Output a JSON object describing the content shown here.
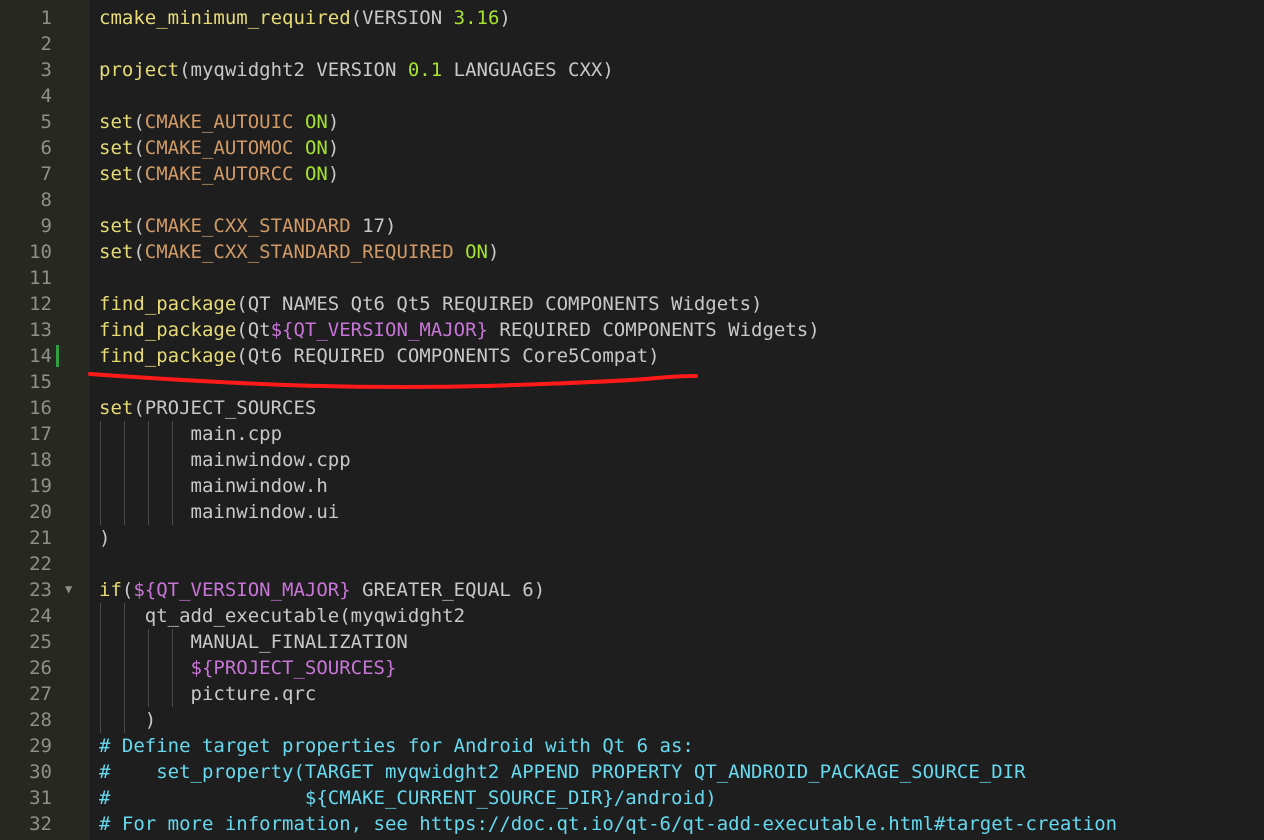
{
  "editor": {
    "lines": [
      {
        "n": "1",
        "tokens": [
          [
            "fn",
            "cmake_minimum_required"
          ],
          [
            "arg",
            "(VERSION "
          ],
          [
            "ver",
            "3.16"
          ],
          [
            "arg",
            ")"
          ]
        ]
      },
      {
        "n": "2",
        "tokens": []
      },
      {
        "n": "3",
        "tokens": [
          [
            "fn",
            "project"
          ],
          [
            "arg",
            "(myqwidght2 VERSION "
          ],
          [
            "ver",
            "0.1"
          ],
          [
            "arg",
            " LANGUAGES CXX)"
          ]
        ]
      },
      {
        "n": "4",
        "tokens": []
      },
      {
        "n": "5",
        "tokens": [
          [
            "fn",
            "set"
          ],
          [
            "arg",
            "("
          ],
          [
            "var2",
            "CMAKE_AUTOUIC"
          ],
          [
            "arg",
            " "
          ],
          [
            "on",
            "ON"
          ],
          [
            "arg",
            ")"
          ]
        ]
      },
      {
        "n": "6",
        "tokens": [
          [
            "fn",
            "set"
          ],
          [
            "arg",
            "("
          ],
          [
            "var2",
            "CMAKE_AUTOMOC"
          ],
          [
            "arg",
            " "
          ],
          [
            "on",
            "ON"
          ],
          [
            "arg",
            ")"
          ]
        ]
      },
      {
        "n": "7",
        "tokens": [
          [
            "fn",
            "set"
          ],
          [
            "arg",
            "("
          ],
          [
            "var2",
            "CMAKE_AUTORCC"
          ],
          [
            "arg",
            " "
          ],
          [
            "on",
            "ON"
          ],
          [
            "arg",
            ")"
          ]
        ]
      },
      {
        "n": "8",
        "tokens": []
      },
      {
        "n": "9",
        "tokens": [
          [
            "fn",
            "set"
          ],
          [
            "arg",
            "("
          ],
          [
            "var2",
            "CMAKE_CXX_STANDARD"
          ],
          [
            "arg",
            " 17)"
          ]
        ]
      },
      {
        "n": "10",
        "tokens": [
          [
            "fn",
            "set"
          ],
          [
            "arg",
            "("
          ],
          [
            "var2",
            "CMAKE_CXX_STANDARD_REQUIRED"
          ],
          [
            "arg",
            " "
          ],
          [
            "on",
            "ON"
          ],
          [
            "arg",
            ")"
          ]
        ]
      },
      {
        "n": "11",
        "tokens": []
      },
      {
        "n": "12",
        "tokens": [
          [
            "fn",
            "find_package"
          ],
          [
            "arg",
            "(QT NAMES Qt6 Qt5 REQUIRED COMPONENTS Widgets)"
          ]
        ]
      },
      {
        "n": "13",
        "tokens": [
          [
            "fn",
            "find_package"
          ],
          [
            "arg",
            "(Qt"
          ],
          [
            "vr",
            "${QT_VERSION_MAJOR}"
          ],
          [
            "arg",
            " REQUIRED COMPONENTS Widgets)"
          ]
        ]
      },
      {
        "n": "14",
        "tokens": [
          [
            "fn",
            "find_package"
          ],
          [
            "arg",
            "(Qt6 REQUIRED COMPONENTS Core5Compat)"
          ]
        ],
        "modified": true
      },
      {
        "n": "15",
        "tokens": []
      },
      {
        "n": "16",
        "tokens": [
          [
            "fn",
            "set"
          ],
          [
            "arg",
            "(PROJECT_SOURCES"
          ]
        ]
      },
      {
        "n": "17",
        "tokens": [
          [
            "arg",
            "        main.cpp"
          ]
        ]
      },
      {
        "n": "18",
        "tokens": [
          [
            "arg",
            "        mainwindow.cpp"
          ]
        ]
      },
      {
        "n": "19",
        "tokens": [
          [
            "arg",
            "        mainwindow.h"
          ]
        ]
      },
      {
        "n": "20",
        "tokens": [
          [
            "arg",
            "        mainwindow.ui"
          ]
        ]
      },
      {
        "n": "21",
        "tokens": [
          [
            "arg",
            ")"
          ]
        ]
      },
      {
        "n": "22",
        "tokens": []
      },
      {
        "n": "23",
        "tokens": [
          [
            "fn",
            "if"
          ],
          [
            "arg",
            "("
          ],
          [
            "vr",
            "${QT_VERSION_MAJOR}"
          ],
          [
            "arg",
            " GREATER_EQUAL 6)"
          ]
        ],
        "fold": true
      },
      {
        "n": "24",
        "tokens": [
          [
            "arg",
            "    qt_add_executable(myqwidght2"
          ]
        ]
      },
      {
        "n": "25",
        "tokens": [
          [
            "arg",
            "        MANUAL_FINALIZATION"
          ]
        ]
      },
      {
        "n": "26",
        "tokens": [
          [
            "arg",
            "        "
          ],
          [
            "vr",
            "${PROJECT_SOURCES}"
          ]
        ]
      },
      {
        "n": "27",
        "tokens": [
          [
            "arg",
            "        picture.qrc"
          ]
        ]
      },
      {
        "n": "28",
        "tokens": [
          [
            "arg",
            "    )"
          ]
        ]
      },
      {
        "n": "29",
        "tokens": [
          [
            "cm",
            "# Define target properties for Android with Qt 6 as:"
          ]
        ]
      },
      {
        "n": "30",
        "tokens": [
          [
            "cm",
            "#    set_property(TARGET myqwidght2 APPEND PROPERTY QT_ANDROID_PACKAGE_SOURCE_DIR"
          ]
        ]
      },
      {
        "n": "31",
        "tokens": [
          [
            "cm",
            "#                 ${CMAKE_CURRENT_SOURCE_DIR}/android)"
          ]
        ]
      },
      {
        "n": "32",
        "tokens": [
          [
            "cm",
            "# For more information, see https://doc.qt.io/qt-6/qt-add-executable.html#target-creation"
          ]
        ]
      }
    ]
  },
  "colors": {
    "background": "#1e1e1e",
    "gutter": "#272822",
    "function": "#e6db74",
    "variable": "#d19a66",
    "on_keyword": "#a6e22e",
    "version": "#a6e22e",
    "var_ref": "#c875d8",
    "comment": "#66d9ef",
    "annotation_underline": "#ff1a1a"
  },
  "icons": {
    "fold": "chevron-down-icon"
  }
}
